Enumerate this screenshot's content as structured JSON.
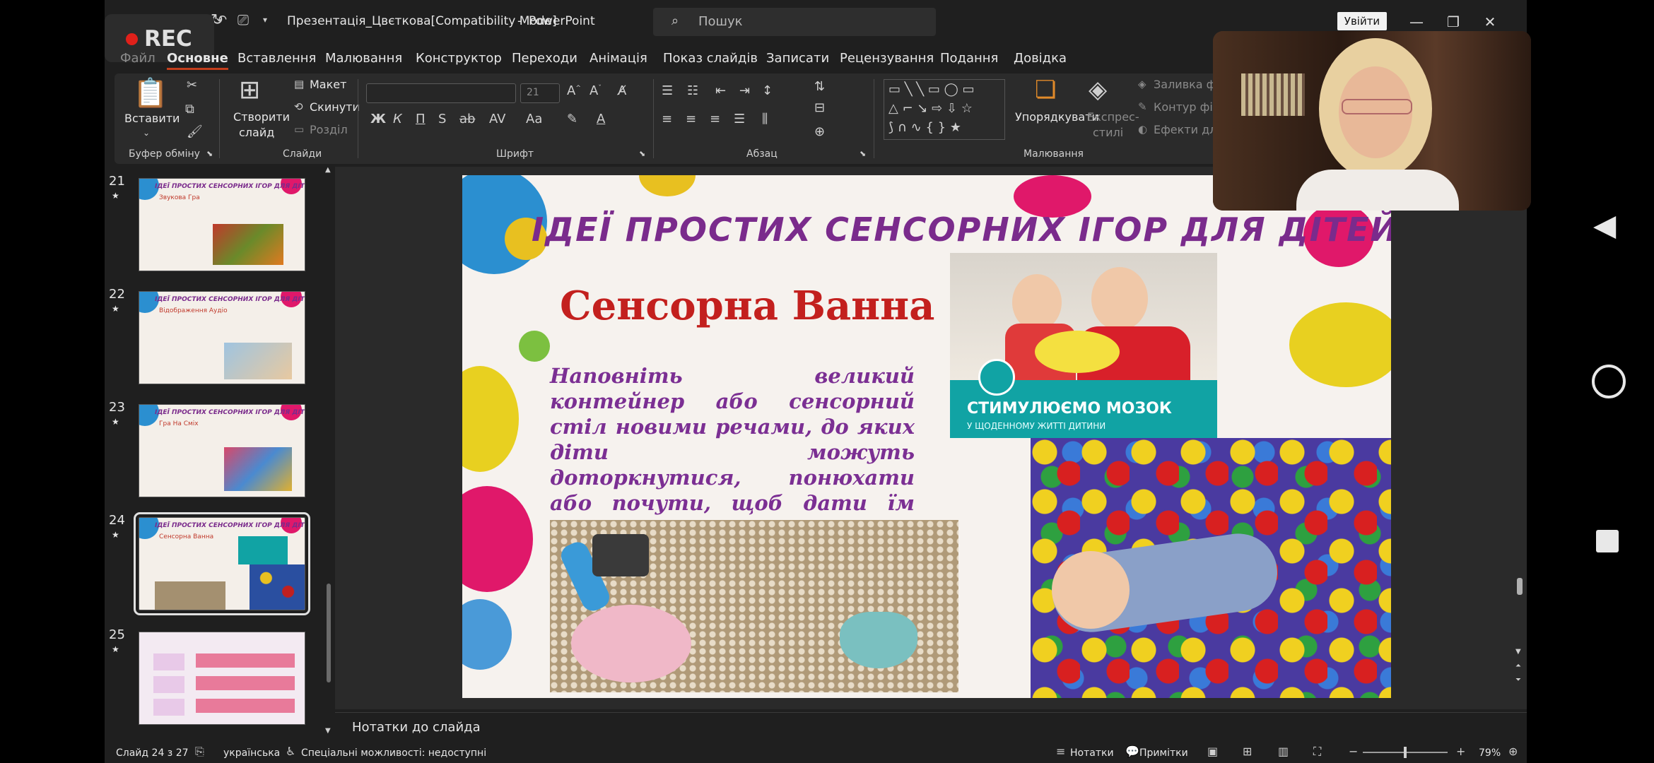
{
  "recording": {
    "label": "REC"
  },
  "titlebar": {
    "doc_title": "Презентація_Цвєткова[Compatibility Mode]",
    "separator": "-",
    "app_name": "PowerPoint",
    "search_placeholder": "Пошук",
    "signin_label": "Увійти"
  },
  "tabs": [
    {
      "label": "Файл"
    },
    {
      "label": "Основне"
    },
    {
      "label": "Вставлення"
    },
    {
      "label": "Малювання"
    },
    {
      "label": "Конструктор"
    },
    {
      "label": "Переходи"
    },
    {
      "label": "Анімація"
    },
    {
      "label": "Показ слайдів"
    },
    {
      "label": "Записати"
    },
    {
      "label": "Рецензування"
    },
    {
      "label": "Подання"
    },
    {
      "label": "Довідка"
    }
  ],
  "ribbon": {
    "clipboard": {
      "group": "Буфер обміну",
      "paste": "Вставити"
    },
    "slides": {
      "group": "Слайди",
      "new_slide_1": "Створити",
      "new_slide_2": "слайд",
      "layout": "Макет",
      "reset": "Скинути",
      "sections": "Розділ"
    },
    "font": {
      "group": "Шрифт",
      "font_size": "21"
    },
    "paragraph": {
      "group": "Абзац"
    },
    "drawing": {
      "group": "Малювання",
      "arrange": "Упорядкувати",
      "quick_styles_1": "Експрес-",
      "quick_styles_2": "стилі",
      "fill": "Заливка фігури",
      "outline": "Контур фігури",
      "effects": "Ефекти для фігури"
    }
  },
  "thumbnails": [
    {
      "number": "21",
      "title": "ІДЕЇ ПРОСТИХ СЕНСОРНИХ ІГОР ДЛЯ ДІТЕЙ",
      "subtitle": "Звукова Гра"
    },
    {
      "number": "22",
      "title": "ІДЕЇ ПРОСТИХ СЕНСОРНИХ ІГОР ДЛЯ ДІТЕЙ",
      "subtitle": "Відображення Аудіо"
    },
    {
      "number": "23",
      "title": "ІДЕЇ ПРОСТИХ СЕНСОРНИХ ІГОР ДЛЯ ДІТЕЙ",
      "subtitle": "Гра На Сміх"
    },
    {
      "number": "24",
      "title": "ІДЕЇ ПРОСТИХ СЕНСОРНИХ ІГОР ДЛЯ ДІТЕЙ",
      "subtitle": "Сенсорна Ванна"
    },
    {
      "number": "25",
      "title": "",
      "subtitle": ""
    }
  ],
  "slide": {
    "title": "ІДЕЇ ПРОСТИХ СЕНСОРНИХ ІГОР ДЛЯ ДІТЕЙ",
    "subtitle": "Сенсорна Ванна",
    "body": "Наповніть великий контейнер або сенсорний стіл новими речами, до яких діти можуть доторкнутися, понюхати або почути, щоб дати їм нову сенсорну інформацію.",
    "banner_title": "СТИМУЛЮЄМО МОЗОК",
    "banner_subtitle": "У ЩОДЕННОМУ ЖИТТІ ДИТИНИ"
  },
  "notes": {
    "label": "Нотатки до слайда"
  },
  "status": {
    "slide_counter": "Слайд 24 з 27",
    "language": "українська",
    "accessibility": "Спеціальні можливості: недоступні",
    "notes_btn": "Нотатки",
    "comments_btn": "Примітки",
    "zoom": "79%"
  },
  "colors": {
    "accent": "#c43e1c",
    "title_purple": "#7a2b8c",
    "subtitle_red": "#c3201e"
  }
}
